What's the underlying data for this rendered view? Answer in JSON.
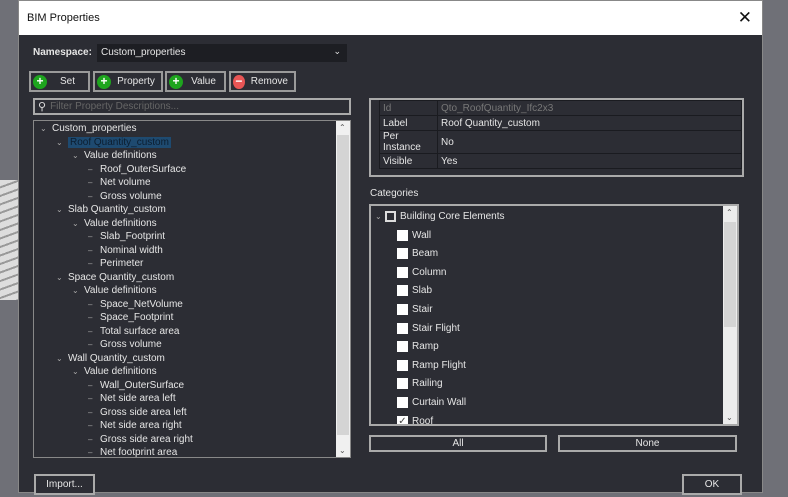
{
  "dialog": {
    "title": "BIM Properties",
    "close": "✕"
  },
  "namespace": {
    "label": "Namespace:",
    "value": "Custom_properties"
  },
  "toolbar": {
    "set": "Set",
    "property": "Property",
    "value": "Value",
    "remove": "Remove"
  },
  "filter": {
    "placeholder": "Filter Property Descriptions..."
  },
  "tree": [
    {
      "label": "Custom_properties",
      "level": 0,
      "expander": true
    },
    {
      "label": "Roof Quantity_custom",
      "level": 1,
      "expander": true,
      "selected": true
    },
    {
      "label": "Value definitions",
      "level": 2,
      "expander": true
    },
    {
      "label": "Roof_OuterSurface",
      "level": 3
    },
    {
      "label": "Net volume",
      "level": 3
    },
    {
      "label": "Gross volume",
      "level": 3
    },
    {
      "label": "Slab Quantity_custom",
      "level": 1,
      "expander": true
    },
    {
      "label": "Value definitions",
      "level": 2,
      "expander": true
    },
    {
      "label": "Slab_Footprint",
      "level": 3
    },
    {
      "label": "Nominal width",
      "level": 3
    },
    {
      "label": "Perimeter",
      "level": 3
    },
    {
      "label": "Space Quantity_custom",
      "level": 1,
      "expander": true
    },
    {
      "label": "Value definitions",
      "level": 2,
      "expander": true
    },
    {
      "label": "Space_NetVolume",
      "level": 3
    },
    {
      "label": "Space_Footprint",
      "level": 3
    },
    {
      "label": "Total surface area",
      "level": 3
    },
    {
      "label": "Gross volume",
      "level": 3
    },
    {
      "label": "Wall Quantity_custom",
      "level": 1,
      "expander": true
    },
    {
      "label": "Value definitions",
      "level": 2,
      "expander": true
    },
    {
      "label": "Wall_OuterSurface",
      "level": 3
    },
    {
      "label": "Net side area left",
      "level": 3
    },
    {
      "label": "Gross side area left",
      "level": 3
    },
    {
      "label": "Net side area right",
      "level": 3
    },
    {
      "label": "Gross side area right",
      "level": 3
    },
    {
      "label": "Net footprint area",
      "level": 3
    }
  ],
  "properties": [
    {
      "key": "Id",
      "value": "Qto_RoofQuantity_Ifc2x3",
      "dim": true
    },
    {
      "key": "Label",
      "value": "Roof Quantity_custom"
    },
    {
      "key": "Per Instance",
      "value": "No"
    },
    {
      "key": "Visible",
      "value": "Yes"
    }
  ],
  "categories": {
    "label": "Categories",
    "group": "Building Core Elements",
    "items": [
      {
        "label": "Wall",
        "checked": false
      },
      {
        "label": "Beam",
        "checked": false
      },
      {
        "label": "Column",
        "checked": false
      },
      {
        "label": "Slab",
        "checked": false
      },
      {
        "label": "Stair",
        "checked": false
      },
      {
        "label": "Stair Flight",
        "checked": false
      },
      {
        "label": "Ramp",
        "checked": false
      },
      {
        "label": "Ramp Flight",
        "checked": false
      },
      {
        "label": "Railing",
        "checked": false
      },
      {
        "label": "Curtain Wall",
        "checked": false
      },
      {
        "label": "Roof",
        "checked": true
      }
    ],
    "all": "All",
    "none": "None"
  },
  "footer": {
    "import": "Import...",
    "ok": "OK"
  }
}
